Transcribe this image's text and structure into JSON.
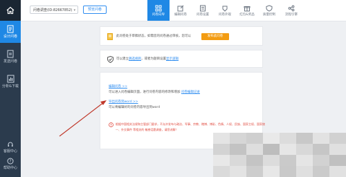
{
  "sidebar": {
    "items": [
      {
        "label": "设计问卷",
        "icon": "document-edit-icon",
        "active": true
      },
      {
        "label": "发送问卷",
        "icon": "send-icon",
        "active": false
      },
      {
        "label": "分析&下载",
        "icon": "chart-icon",
        "active": false
      }
    ],
    "bottom": [
      {
        "label": "客服中心",
        "icon": "headset-icon"
      },
      {
        "label": "帮助中心",
        "icon": "help-icon"
      }
    ]
  },
  "header": {
    "survey_select": "问卷调查(ID:82667852)",
    "preview_label": "预览问卷",
    "tabs": [
      {
        "label": "问卷向导",
        "icon": "grid-icon",
        "active": true
      },
      {
        "label": "编辑问卷",
        "icon": "edit-icon",
        "active": false
      },
      {
        "label": "问卷设置",
        "icon": "settings-icon",
        "active": false
      },
      {
        "label": "问卷外观",
        "icon": "appearance-icon",
        "active": false
      },
      {
        "label": "红包&奖品",
        "icon": "gift-icon",
        "active": false
      },
      {
        "label": "质量控制",
        "icon": "shield-icon",
        "active": false
      },
      {
        "label": "流程引擎",
        "icon": "flow-icon",
        "active": false
      }
    ]
  },
  "main": {
    "card1": {
      "text": "此问卷处于草稿状态，如需您的问卷通过审核，您可以",
      "button": "发布此问卷"
    },
    "card2": {
      "text_a": "可以建立",
      "link_a": "跳选规则",
      "text_b": "，或者为题目设置",
      "link_b": "显示逻辑"
    },
    "card3": {
      "edit_link": "编辑问卷 >>",
      "edit_desc": "可以进入问卷编辑页面，进行问卷内容的修改和增加",
      "edit_desc_link": "问卷编辑记录",
      "export_link": "导出问卷到word >>",
      "export_desc": "可以将编辑好的问卷内容导出到word",
      "warning_line1": "根据中国相关法规和主管部门要求，不允许发布与政治、军事、宗教、赌博、博彩、色情、人权、民族、国家主权、国家统",
      "warning_line2": "一、外交事件 等相关的 敏感话题调查，请您谅解！"
    }
  }
}
